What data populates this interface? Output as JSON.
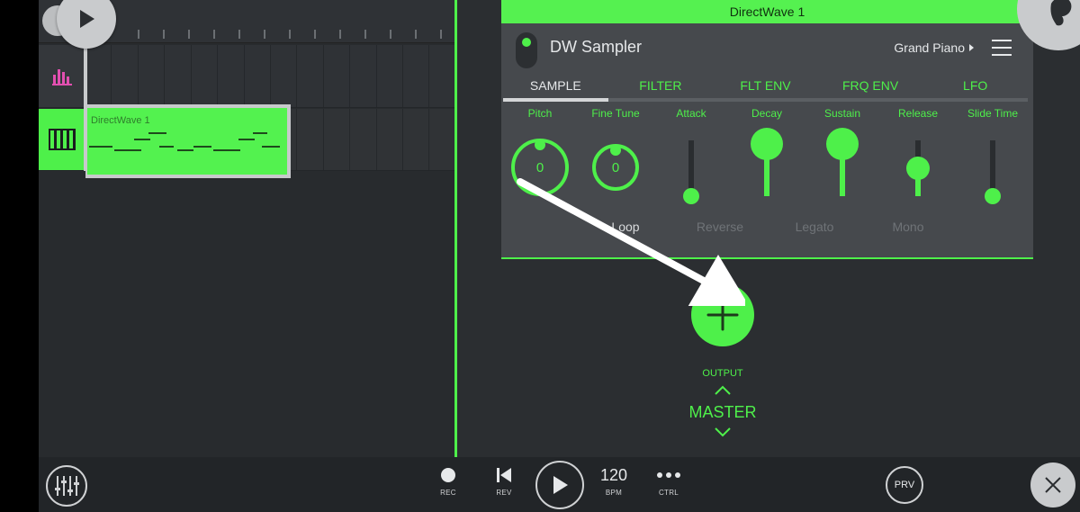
{
  "playlist": {
    "clip_label": "DirectWave 1"
  },
  "plugin": {
    "window_title": "DirectWave 1",
    "name": "DW Sampler",
    "preset": "Grand Piano",
    "tabs": [
      {
        "label": "SAMPLE",
        "active": true
      },
      {
        "label": "FILTER",
        "active": false
      },
      {
        "label": "FLT ENV",
        "active": false
      },
      {
        "label": "FRQ ENV",
        "active": false
      },
      {
        "label": "LFO",
        "active": false
      }
    ],
    "controls": {
      "pitch": {
        "label": "Pitch",
        "value": "0"
      },
      "fine_tune": {
        "label": "Fine Tune",
        "value": "0"
      },
      "attack": {
        "label": "Attack",
        "level": 0.0
      },
      "decay": {
        "label": "Decay",
        "level": 1.0
      },
      "sustain": {
        "label": "Sustain",
        "level": 1.0
      },
      "release": {
        "label": "Release",
        "level": 0.5
      },
      "slide_time": {
        "label": "Slide Time",
        "level": 0.0
      }
    },
    "toggles": [
      {
        "label": "Loop",
        "on": true
      },
      {
        "label": "Reverse",
        "on": false
      },
      {
        "label": "Legato",
        "on": false
      },
      {
        "label": "Mono",
        "on": false
      }
    ]
  },
  "output": {
    "label": "OUTPUT",
    "target": "MASTER"
  },
  "transport": {
    "rec": "REC",
    "rev": "REV",
    "bpm_value": "120",
    "bpm": "BPM",
    "ctrl": "CTRL",
    "prv": "PRV"
  },
  "colors": {
    "accent": "#4ef04a",
    "background": "#2a2d30",
    "panel": "#46494d"
  }
}
